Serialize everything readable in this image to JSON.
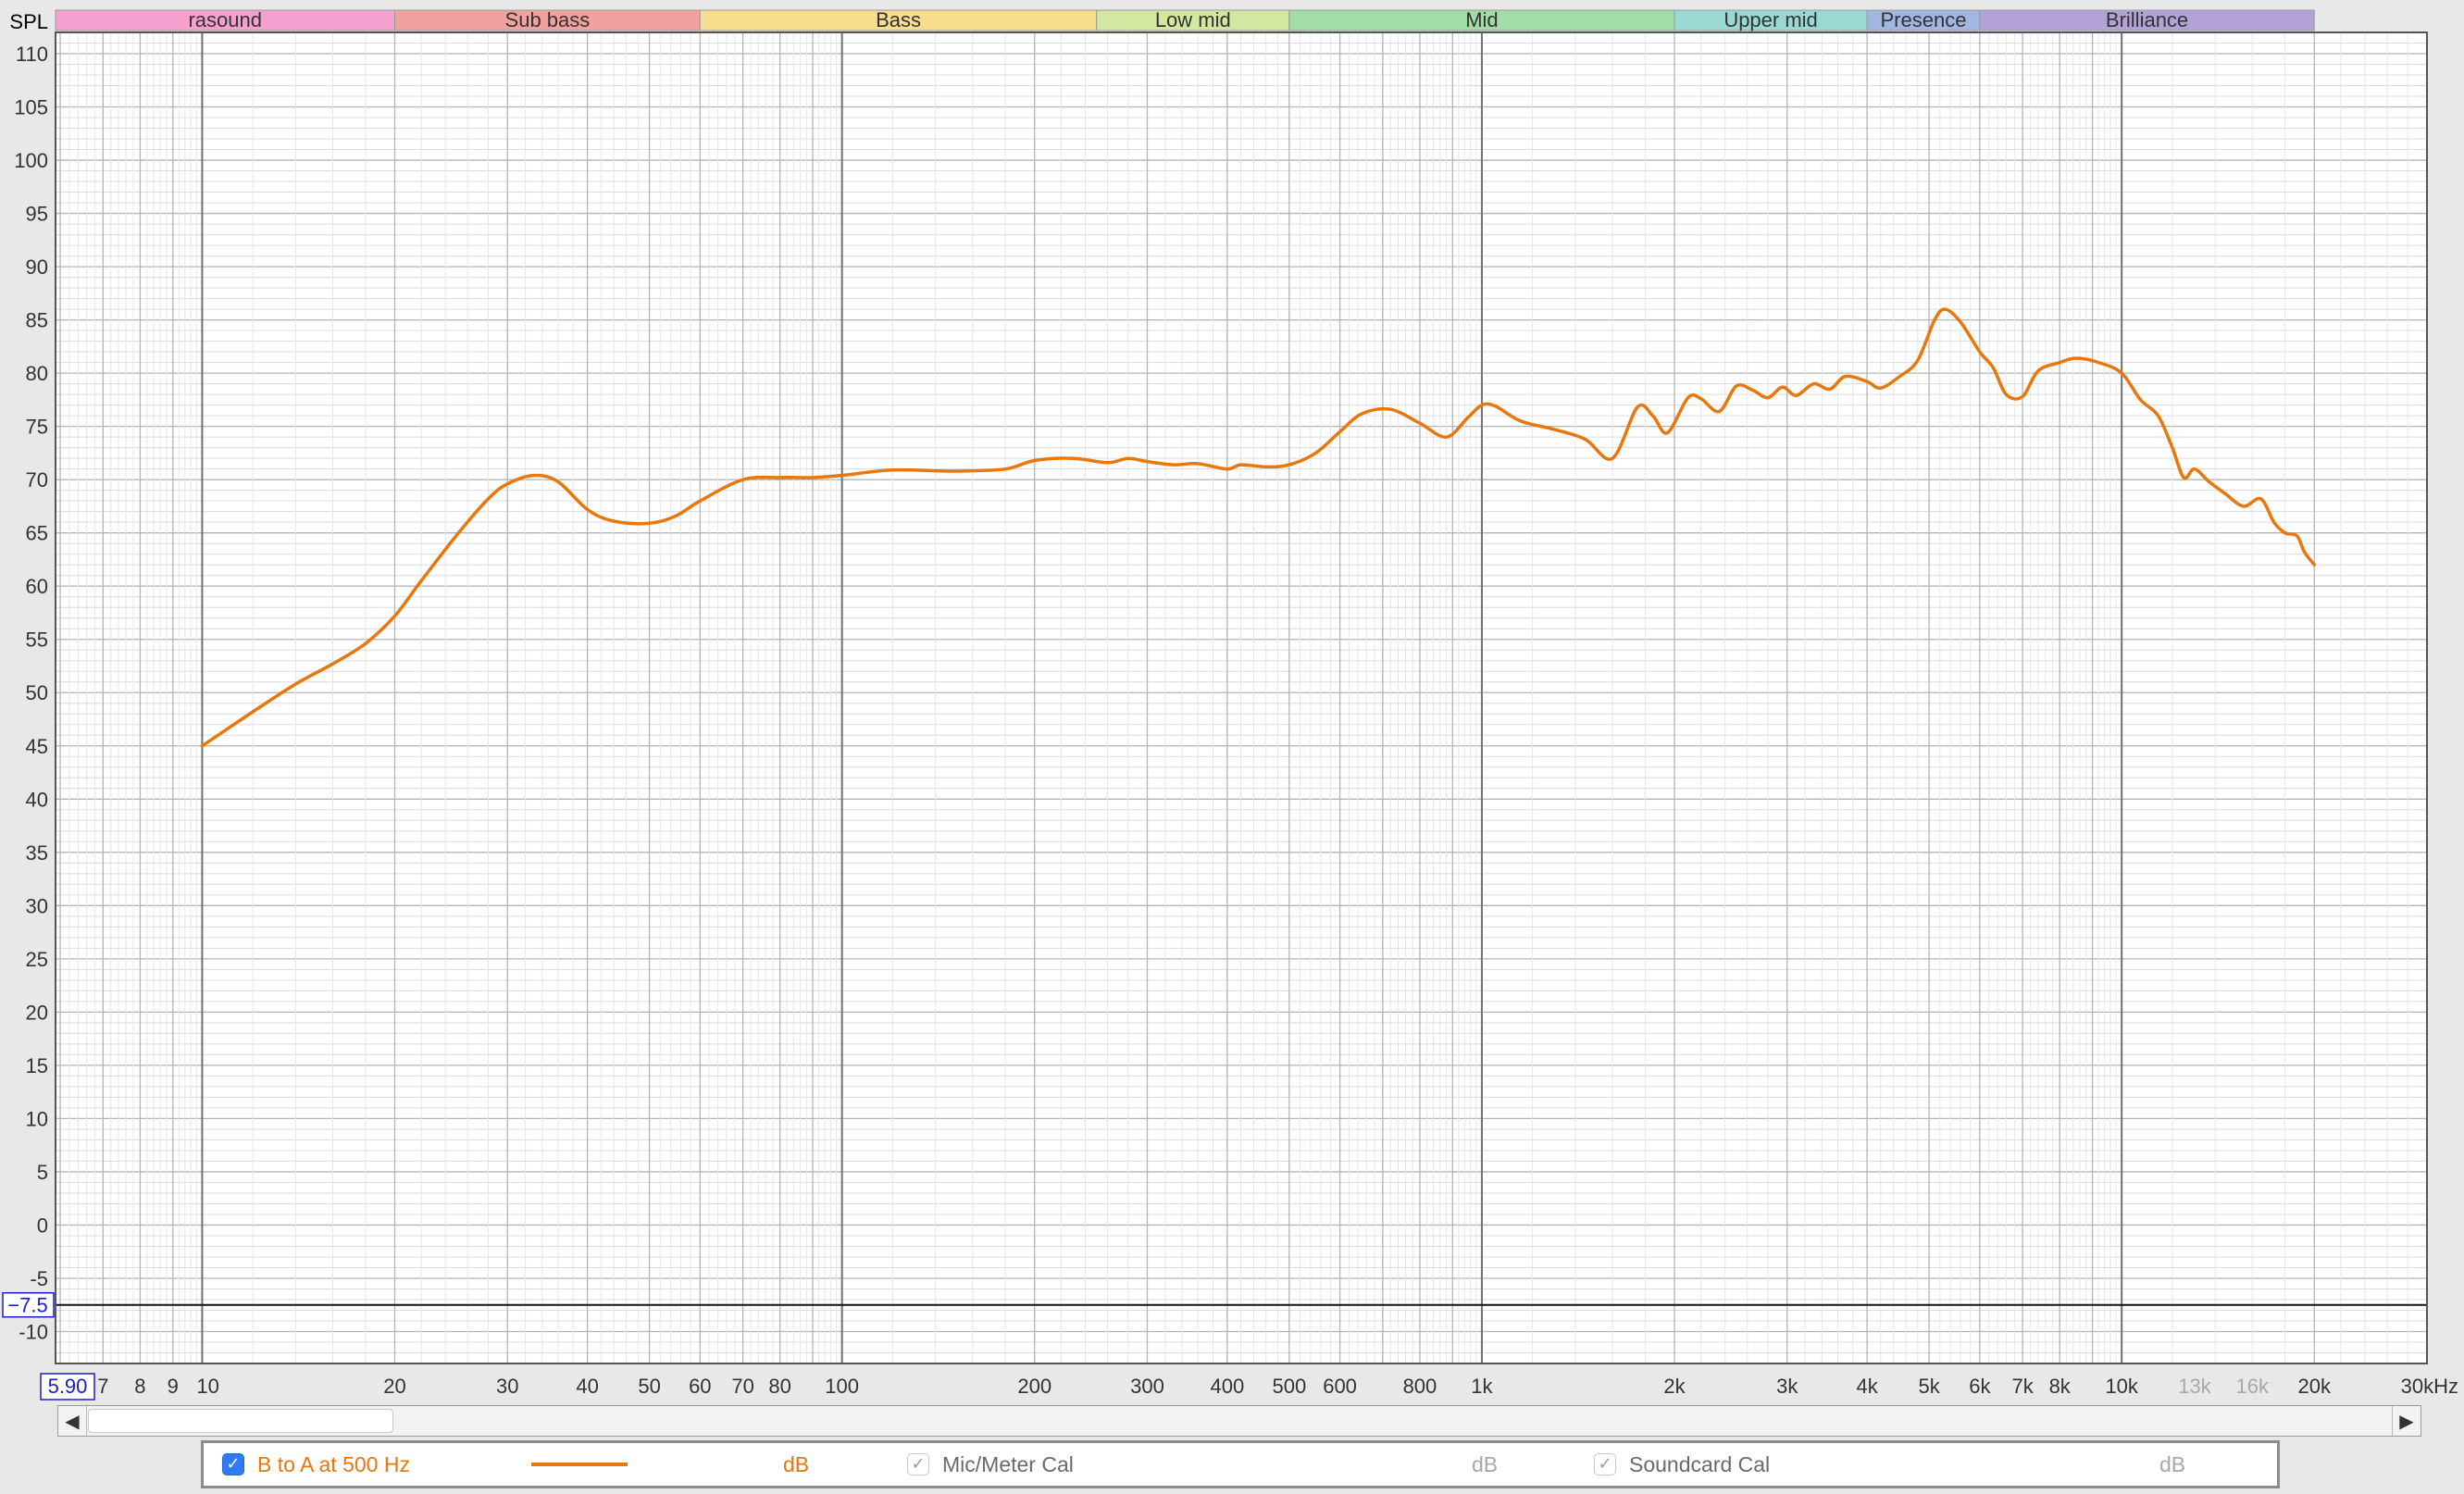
{
  "chart_data": {
    "type": "line",
    "ylabel": "SPL",
    "x_scale": "log",
    "xlim": [
      5.9,
      30000
    ],
    "ylim": [
      -13,
      112
    ],
    "grid": true,
    "x_tick_labels": [
      {
        "f": 7,
        "label": "7"
      },
      {
        "f": 8,
        "label": "8"
      },
      {
        "f": 9,
        "label": "9"
      },
      {
        "f": 10,
        "label": "10"
      },
      {
        "f": 20,
        "label": "20"
      },
      {
        "f": 30,
        "label": "30"
      },
      {
        "f": 40,
        "label": "40"
      },
      {
        "f": 50,
        "label": "50"
      },
      {
        "f": 60,
        "label": "60"
      },
      {
        "f": 70,
        "label": "70"
      },
      {
        "f": 80,
        "label": "80"
      },
      {
        "f": 100,
        "label": "100"
      },
      {
        "f": 200,
        "label": "200"
      },
      {
        "f": 300,
        "label": "300"
      },
      {
        "f": 400,
        "label": "400"
      },
      {
        "f": 500,
        "label": "500"
      },
      {
        "f": 600,
        "label": "600"
      },
      {
        "f": 800,
        "label": "800"
      },
      {
        "f": 1000,
        "label": "1k"
      },
      {
        "f": 2000,
        "label": "2k"
      },
      {
        "f": 3000,
        "label": "3k"
      },
      {
        "f": 4000,
        "label": "4k"
      },
      {
        "f": 5000,
        "label": "5k"
      },
      {
        "f": 6000,
        "label": "6k"
      },
      {
        "f": 7000,
        "label": "7k"
      },
      {
        "f": 8000,
        "label": "8k"
      },
      {
        "f": 10000,
        "label": "10k"
      },
      {
        "f": 13000,
        "label": "13k",
        "dim": true
      },
      {
        "f": 16000,
        "label": "16k",
        "dim": true
      },
      {
        "f": 20000,
        "label": "20k"
      },
      {
        "f": 30000,
        "label": "30kHz"
      }
    ],
    "x_start_label": "5.90",
    "y_ticks": [
      110,
      105,
      100,
      95,
      90,
      85,
      80,
      75,
      70,
      65,
      60,
      55,
      50,
      45,
      40,
      35,
      30,
      25,
      20,
      15,
      10,
      5,
      0,
      -5,
      -10
    ],
    "y_marker": {
      "value": -7.5,
      "label": "−7.5"
    },
    "bands": [
      {
        "label": "rasound",
        "from": 5.9,
        "to": 20,
        "color": "#f6a0d0"
      },
      {
        "label": "Sub bass",
        "from": 20,
        "to": 60,
        "color": "#f2a29e"
      },
      {
        "label": "Bass",
        "from": 60,
        "to": 250,
        "color": "#f8dd8e"
      },
      {
        "label": "Low mid",
        "from": 250,
        "to": 500,
        "color": "#d2e8a0"
      },
      {
        "label": "Mid",
        "from": 500,
        "to": 2000,
        "color": "#a2dca6"
      },
      {
        "label": "Upper mid",
        "from": 2000,
        "to": 4000,
        "color": "#9ad8d4"
      },
      {
        "label": "Presence",
        "from": 4000,
        "to": 6000,
        "color": "#a2b6e2"
      },
      {
        "label": "Brilliance",
        "from": 6000,
        "to": 20000,
        "color": "#b2a2d6"
      }
    ],
    "series": [
      {
        "name": "B to A at 500 Hz",
        "color": "#e8770e",
        "points": [
          [
            10,
            45
          ],
          [
            12,
            48.2
          ],
          [
            14,
            50.8
          ],
          [
            16,
            52.7
          ],
          [
            18,
            54.6
          ],
          [
            20,
            57.2
          ],
          [
            22,
            60.5
          ],
          [
            25,
            64.8
          ],
          [
            28,
            68.2
          ],
          [
            30,
            69.6
          ],
          [
            33,
            70.4
          ],
          [
            36,
            69.8
          ],
          [
            40,
            67.2
          ],
          [
            44,
            66.1
          ],
          [
            50,
            65.9
          ],
          [
            55,
            66.6
          ],
          [
            60,
            68.0
          ],
          [
            70,
            70.0
          ],
          [
            80,
            70.2
          ],
          [
            90,
            70.2
          ],
          [
            100,
            70.4
          ],
          [
            120,
            70.9
          ],
          [
            150,
            70.8
          ],
          [
            180,
            71.0
          ],
          [
            200,
            71.8
          ],
          [
            230,
            72.0
          ],
          [
            260,
            71.6
          ],
          [
            280,
            72.0
          ],
          [
            300,
            71.7
          ],
          [
            330,
            71.4
          ],
          [
            360,
            71.5
          ],
          [
            400,
            71.0
          ],
          [
            420,
            71.4
          ],
          [
            460,
            71.2
          ],
          [
            500,
            71.4
          ],
          [
            550,
            72.5
          ],
          [
            600,
            74.5
          ],
          [
            650,
            76.2
          ],
          [
            720,
            76.6
          ],
          [
            800,
            75.3
          ],
          [
            880,
            74.0
          ],
          [
            950,
            75.8
          ],
          [
            1000,
            77.0
          ],
          [
            1050,
            76.9
          ],
          [
            1150,
            75.5
          ],
          [
            1300,
            74.7
          ],
          [
            1450,
            73.8
          ],
          [
            1600,
            72.0
          ],
          [
            1750,
            76.8
          ],
          [
            1850,
            76.0
          ],
          [
            1950,
            74.4
          ],
          [
            2100,
            77.7
          ],
          [
            2200,
            77.6
          ],
          [
            2350,
            76.4
          ],
          [
            2500,
            78.8
          ],
          [
            2650,
            78.4
          ],
          [
            2800,
            77.7
          ],
          [
            2950,
            78.7
          ],
          [
            3100,
            77.9
          ],
          [
            3300,
            79.0
          ],
          [
            3500,
            78.5
          ],
          [
            3700,
            79.7
          ],
          [
            4000,
            79.2
          ],
          [
            4200,
            78.6
          ],
          [
            4500,
            79.7
          ],
          [
            4800,
            81.2
          ],
          [
            5100,
            85.0
          ],
          [
            5300,
            86.0
          ],
          [
            5600,
            84.8
          ],
          [
            6000,
            82.0
          ],
          [
            6300,
            80.5
          ],
          [
            6600,
            78.0
          ],
          [
            7000,
            77.8
          ],
          [
            7400,
            80.2
          ],
          [
            8000,
            81.0
          ],
          [
            8500,
            81.4
          ],
          [
            9200,
            81.0
          ],
          [
            10000,
            80.0
          ],
          [
            10700,
            77.5
          ],
          [
            11400,
            76.0
          ],
          [
            12000,
            73.0
          ],
          [
            12500,
            70.2
          ],
          [
            13000,
            71.0
          ],
          [
            13700,
            69.8
          ],
          [
            14500,
            68.7
          ],
          [
            15500,
            67.5
          ],
          [
            16500,
            68.2
          ],
          [
            17300,
            66.0
          ],
          [
            18000,
            65.0
          ],
          [
            18800,
            64.7
          ],
          [
            19300,
            63.2
          ],
          [
            20000,
            62.0
          ]
        ]
      }
    ]
  },
  "legend": {
    "entries": [
      {
        "label": "B to A at 500 Hz",
        "checked": true,
        "unit": "dB",
        "color": "#e8770e"
      },
      {
        "label": "Mic/Meter Cal",
        "checked": false,
        "unit": "dB"
      },
      {
        "label": "Soundcard Cal",
        "checked": false,
        "unit": "dB"
      }
    ]
  },
  "colors": {
    "curve": "#e8770e",
    "accent": "#2f7bf5",
    "marker": "#1c1cc8"
  },
  "icons": {
    "scroll_left": "triangle-left-icon",
    "scroll_right": "triangle-right-icon",
    "check": "checkmark-icon"
  }
}
